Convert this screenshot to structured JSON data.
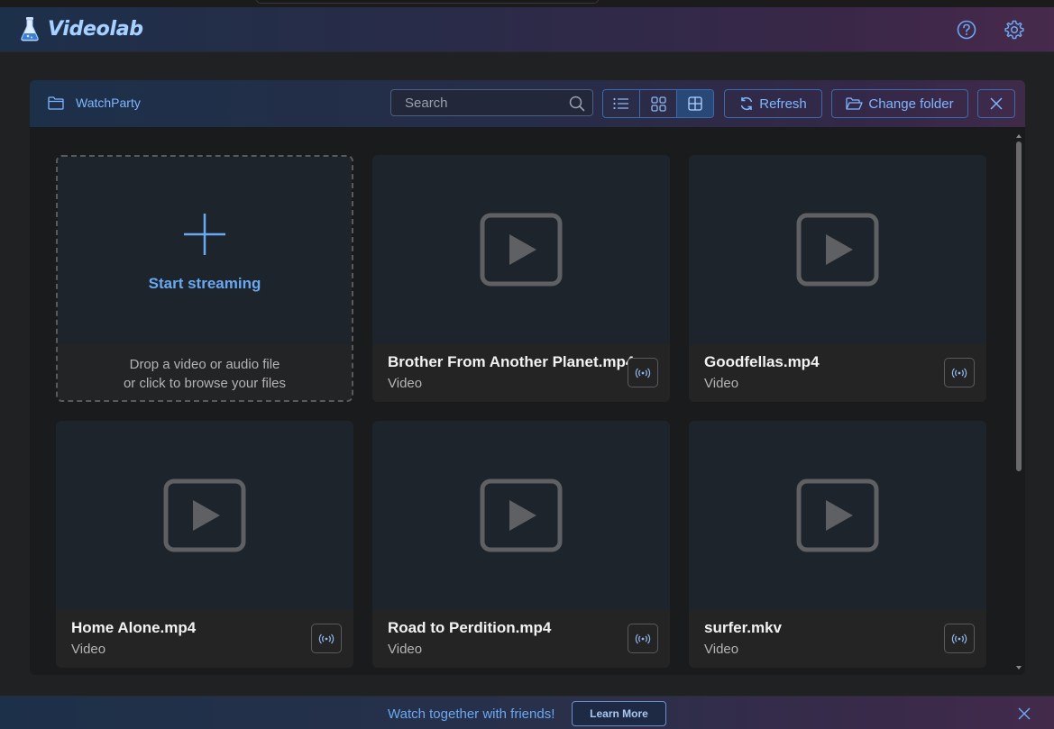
{
  "app": {
    "title": "Videolab"
  },
  "header": {
    "help_icon": "question-circle-icon",
    "settings_icon": "gear-icon"
  },
  "toolbar": {
    "folder_name": "WatchParty",
    "search_placeholder": "Search",
    "view_modes": [
      "list",
      "small-grid",
      "large-grid"
    ],
    "active_view": "large-grid",
    "refresh_label": "Refresh",
    "change_folder_label": "Change folder"
  },
  "upload": {
    "title": "Start streaming",
    "line1": "Drop a video or audio file",
    "line2": "or click to browse your files"
  },
  "files": [
    {
      "name": "Brother From Another Planet.mp4",
      "type": "Video"
    },
    {
      "name": "Goodfellas.mp4",
      "type": "Video"
    },
    {
      "name": "Home Alone.mp4",
      "type": "Video"
    },
    {
      "name": "Road to Perdition.mp4",
      "type": "Video"
    },
    {
      "name": "surfer.mkv",
      "type": "Video"
    }
  ],
  "banner": {
    "text": "Watch together with friends!",
    "button_label": "Learn More"
  },
  "colors": {
    "accent": "#6aa9f2",
    "header_start": "#1d3049",
    "header_end": "#472a4c"
  }
}
